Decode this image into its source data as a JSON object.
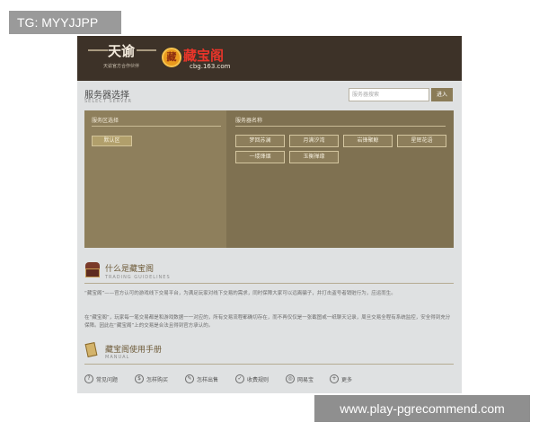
{
  "overlays": {
    "tg_tag": "TG: MYYJJPP",
    "watermark": "www.play-pgrecommend.com"
  },
  "header": {
    "game_logo": {
      "title": "天谕",
      "tagline": "天谕官方合作伙伴"
    },
    "cbg_logo": {
      "coin": "藏",
      "name": "藏宝阁",
      "domain": "cbg.163.com"
    }
  },
  "select_server": {
    "title": "服务器选择",
    "subtitle": "SELECT SERVER",
    "search": {
      "placeholder": "服务器搜索",
      "button": "进入"
    },
    "zone_panel": {
      "heading": "服务区选择",
      "zones": [
        "默认区"
      ]
    },
    "server_panel": {
      "heading": "服务器名称",
      "servers": [
        "梦回苏澜",
        "月满汐湾",
        "岩锋聚鲸",
        "星辉花语",
        "一缕烽烟",
        "玉衡禅缘"
      ]
    }
  },
  "what_is": {
    "title": "什么是藏宝阁",
    "subtitle": "TRADING GUIDELINES",
    "paragraph_1": "“藏宝阁”——官方认可的游戏线下交易平台，为满足玩家对线下交易的需求，同时保障大家可以远离骗子，并打击盗号者销赃行为，应运而生。",
    "paragraph_2": "在“藏宝阁”，玩家每一笔交易都是和游戏数据一一对应的，所有交易流程都确切存在，而不再仅仅是一张截图或一纸聊天记录，周旦交易全程有系统监控，安全得到充分保障。因此在“藏宝阁”上的交易是合法且得到官方承认的。"
  },
  "manual": {
    "title": "藏宝阁使用手册",
    "subtitle": "MANUAL",
    "links": [
      {
        "label": "常见问题",
        "icon": "question-icon",
        "glyph": "?"
      },
      {
        "label": "怎样购买",
        "icon": "money-icon",
        "glyph": "$"
      },
      {
        "label": "怎样出售",
        "icon": "edit-icon",
        "glyph": "✎"
      },
      {
        "label": "收费规则",
        "icon": "check-icon",
        "glyph": "✓"
      },
      {
        "label": "网易宝",
        "icon": "coin-icon",
        "glyph": "◎"
      },
      {
        "label": "更多",
        "icon": "plus-icon",
        "glyph": "+"
      }
    ]
  },
  "colors": {
    "topbar": "#3d3228",
    "panel": "#7f7151",
    "accent": "#8a7b57",
    "brand_red": "#e8352a"
  }
}
